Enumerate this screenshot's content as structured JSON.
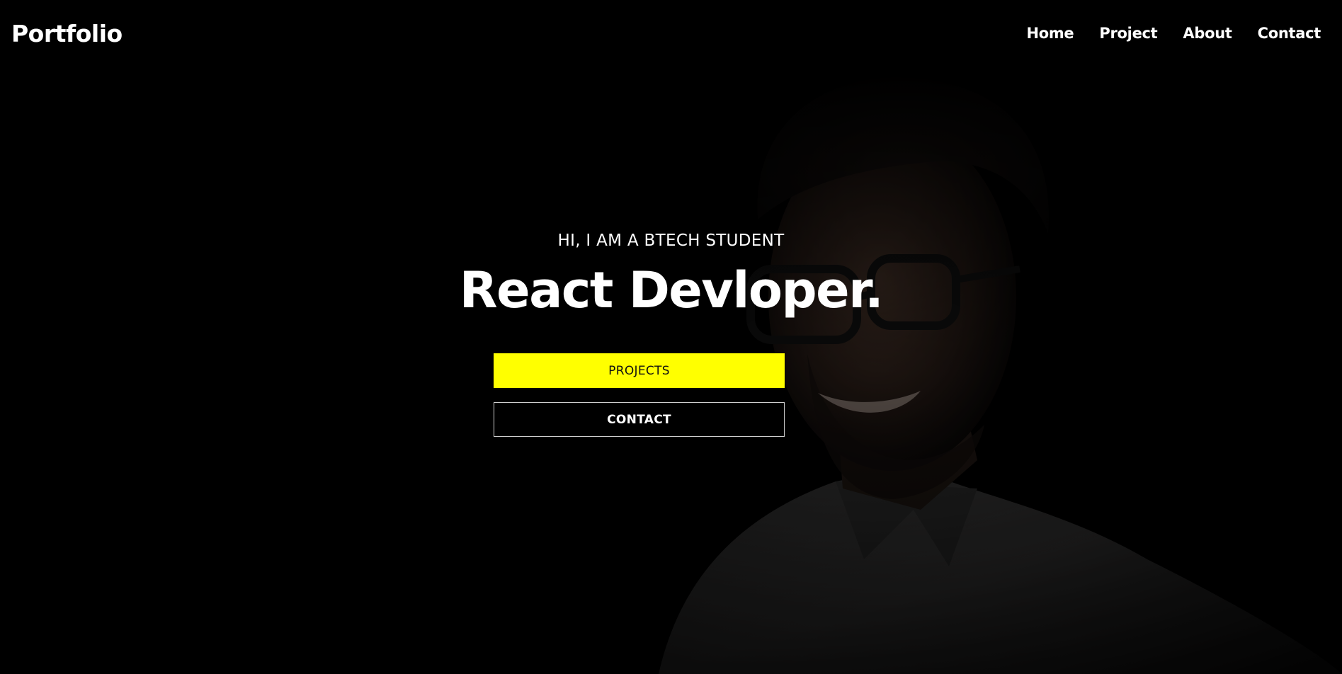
{
  "brand": "Portfolio",
  "nav": {
    "items": [
      {
        "label": "Home"
      },
      {
        "label": "Project"
      },
      {
        "label": "About"
      },
      {
        "label": "Contact"
      }
    ]
  },
  "hero": {
    "eyebrow": "HI, I AM A BTECH STUDENT",
    "headline": "React Devloper.",
    "buttons": {
      "projects": "PROJECTS",
      "contact": "CONTACT"
    }
  },
  "colors": {
    "background": "#000000",
    "accent": "#ffff00",
    "text": "#ffffff"
  }
}
